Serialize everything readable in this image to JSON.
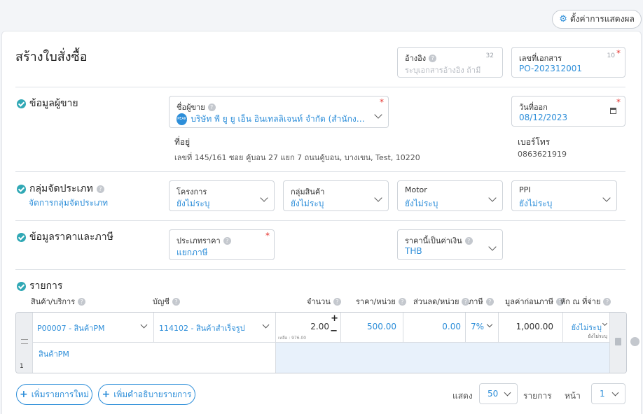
{
  "toolbar": {
    "settings_label": "ตั้งค่าการแสดงผล"
  },
  "page_title": "สร้างใบสั่งซื้อ",
  "reference": {
    "label": "อ้างอิง",
    "counter": "32",
    "placeholder": "ระบุเอกสารอ้างอิง ถ้ามี"
  },
  "doc_number": {
    "label": "เลขที่เอกสาร",
    "counter": "10",
    "value": "PO-202312001"
  },
  "vendor_section": {
    "title": "ข้อมูลผู้ขาย",
    "vendor_label": "ชื่อผู้ขาย",
    "vendor_value": "บริษัท พี ยู ยู เอ็น อินเทลลิเจนท์ จำกัด (สำนักงานให...",
    "address_label": "ที่อยู่",
    "address_value": "เลขที่ 145/161 ซอย คู้บอน 27 แยก 7 ถนนคู้บอน, บางเขน, Test, 10220",
    "issue_date_label": "วันที่ออก",
    "issue_date_value": "08/12/2023",
    "phone_label": "เบอร์โทร",
    "phone_value": "0863621919"
  },
  "category_section": {
    "title": "กลุ่มจัดประเภท",
    "manage_link": "จัดการกลุ่มจัดประเภท",
    "fields": [
      {
        "label": "โครงการ",
        "value": "ยังไม่ระบุ"
      },
      {
        "label": "กลุ่มสินค้า",
        "value": "ยังไม่ระบุ"
      },
      {
        "label": "Motor",
        "value": "ยังไม่ระบุ"
      },
      {
        "label": "PPI",
        "value": "ยังไม่ระบุ"
      }
    ]
  },
  "price_section": {
    "title": "ข้อมูลราคาและภาษี",
    "price_type_label": "ประเภทราคา",
    "price_type_value": "แยกภาษี",
    "currency_label": "ราคานี้เป็นค่าเงิน",
    "currency_value": "THB"
  },
  "items_section": {
    "title": "รายการ",
    "columns": {
      "product": "สินค้า/บริการ",
      "account": "บัญชี",
      "qty": "จำนวน",
      "unit_price": "ราคา/หน่วย",
      "discount": "ส่วนลด/หน่วย",
      "tax": "ภาษี",
      "pre_tax": "มูลค่าก่อนภาษี",
      "withholding": "หัก ณ ที่จ่าย"
    },
    "row": {
      "index": "1",
      "product": "P00007 - สินค้าPM",
      "account": "114102 - สินค้าสำเร็จรูป",
      "qty": "2.00",
      "remaining": "เหลือ : 976.00",
      "unit_price": "500.00",
      "discount": "0.00",
      "tax": "7%",
      "pre_tax": "1,000.00",
      "withholding": "ยังไม่ระบุ",
      "withholding_sub": "ยังไม่ระบุ",
      "description": "สินค้าPM"
    }
  },
  "footer": {
    "add_item": "เพิ่มรายการใหม่",
    "add_desc": "เพิ่มคำอธิบายรายการ",
    "show_label": "แสดง",
    "page_size": "50",
    "items_label": "รายการ",
    "page_label": "หน้า",
    "page_value": "1"
  },
  "colors": {
    "accent": "#2d8ed9",
    "check": "#30a8b5",
    "required": "#e5322d",
    "row_highlight": "#e8f1fb"
  }
}
